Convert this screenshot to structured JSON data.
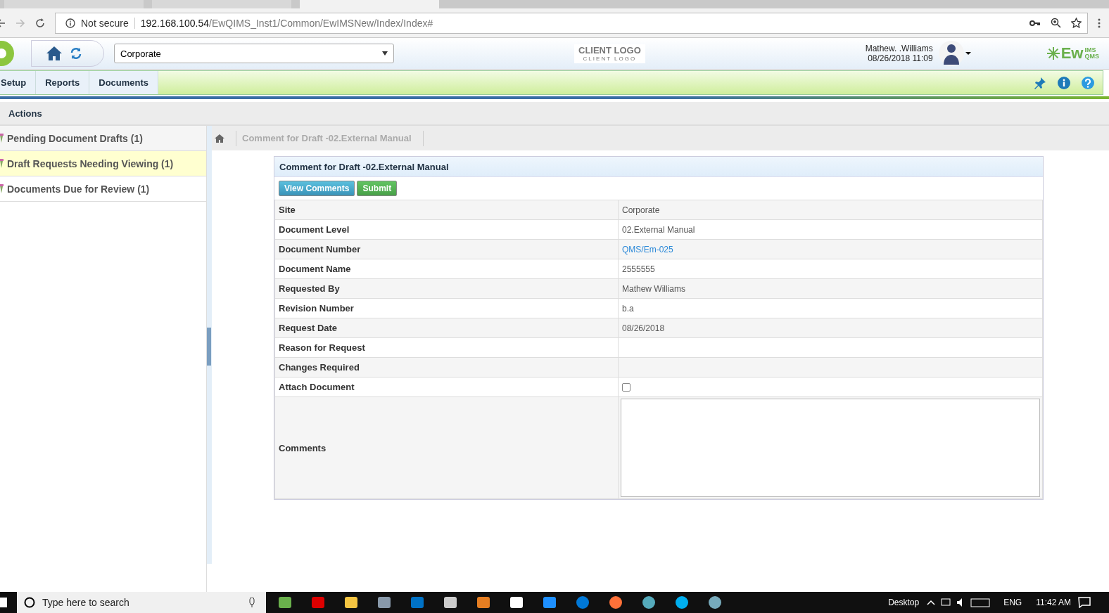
{
  "browser": {
    "tabs": [
      {
        "selected": false
      },
      {
        "selected": false
      },
      {
        "selected": true
      }
    ],
    "security": "Not secure",
    "url_host": "192.168.100.54",
    "url_path": "/EwQIMS_Inst1/Common/EwIMSNew/Index/Index#"
  },
  "header": {
    "site_select": "Corporate",
    "client_logo": "CLIENT LOGO",
    "client_logo_sub": "CLIENT LOGO",
    "user_name": "Mathew. .Williams",
    "datetime": "08/26/2018 11:09",
    "brand": "Ew",
    "brand_sup": "IMS",
    "brand_sub": "QMS"
  },
  "nav": [
    {
      "label": "Setup",
      "selected": false
    },
    {
      "label": "Reports",
      "selected": false
    },
    {
      "label": "Documents",
      "selected": false
    }
  ],
  "actions_title": "Actions",
  "sidebar": [
    {
      "label": "Pending Document Drafts (1)",
      "selected": false
    },
    {
      "label": "Draft Requests Needing Viewing (1)",
      "selected": true
    },
    {
      "label": "Documents Due for Review (1)",
      "selected": false
    }
  ],
  "breadcrumb": "Comment for Draft -02.External Manual",
  "form": {
    "title": "Comment for Draft -02.External Manual",
    "buttons": [
      {
        "label": "View Comments",
        "kind": "info"
      },
      {
        "label": "Submit",
        "kind": "success"
      }
    ],
    "rows": [
      {
        "label": "Site",
        "kind": "text",
        "value": "Corporate"
      },
      {
        "label": "Document Level",
        "kind": "text",
        "value": "02.External Manual"
      },
      {
        "label": "Document Number",
        "kind": "link",
        "value": "QMS/Em-025"
      },
      {
        "label": "Document Name",
        "kind": "text",
        "value": "2555555"
      },
      {
        "label": "Requested By",
        "kind": "text",
        "value": "Mathew Williams"
      },
      {
        "label": "Revision Number",
        "kind": "text",
        "value": "b.a"
      },
      {
        "label": "Request Date",
        "kind": "text",
        "value": "08/26/2018"
      },
      {
        "label": "Reason for Request",
        "kind": "text"
      },
      {
        "label": "Changes Required",
        "kind": "text"
      },
      {
        "label": "Attach Document",
        "kind": "checkbox",
        "checked": false
      },
      {
        "label": "Comments",
        "kind": "textarea"
      }
    ]
  },
  "taskbar": {
    "search_placeholder": "Type here to search",
    "desktop": "Desktop",
    "language": "ENG",
    "time": "11:42 AM"
  }
}
